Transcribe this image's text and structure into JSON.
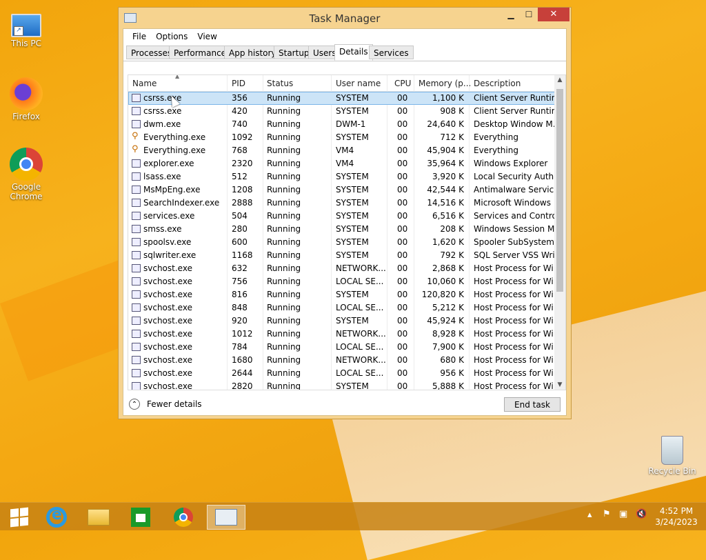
{
  "desktop": {
    "icons": [
      {
        "label": "This PC"
      },
      {
        "label": "Firefox"
      },
      {
        "label": "Google Chrome"
      },
      {
        "label": "Recycle Bin"
      }
    ]
  },
  "window": {
    "title": "Task Manager",
    "menu": [
      "File",
      "Options",
      "View"
    ],
    "tabs": [
      "Processes",
      "Performance",
      "App history",
      "Startup",
      "Users",
      "Details",
      "Services"
    ],
    "active_tab": "Details",
    "columns": [
      "Name",
      "PID",
      "Status",
      "User name",
      "CPU",
      "Memory (p...",
      "Description"
    ],
    "rows": [
      [
        "csrss.exe",
        "356",
        "Running",
        "SYSTEM",
        "00",
        "1,100 K",
        "Client Server Runtim..."
      ],
      [
        "csrss.exe",
        "420",
        "Running",
        "SYSTEM",
        "00",
        "908 K",
        "Client Server Runtim..."
      ],
      [
        "dwm.exe",
        "740",
        "Running",
        "DWM-1",
        "00",
        "24,640 K",
        "Desktop Window M..."
      ],
      [
        "Everything.exe",
        "1092",
        "Running",
        "SYSTEM",
        "00",
        "712 K",
        "Everything"
      ],
      [
        "Everything.exe",
        "768",
        "Running",
        "VM4",
        "00",
        "45,904 K",
        "Everything"
      ],
      [
        "explorer.exe",
        "2320",
        "Running",
        "VM4",
        "00",
        "35,964 K",
        "Windows Explorer"
      ],
      [
        "lsass.exe",
        "512",
        "Running",
        "SYSTEM",
        "00",
        "3,920 K",
        "Local Security Auth..."
      ],
      [
        "MsMpEng.exe",
        "1208",
        "Running",
        "SYSTEM",
        "00",
        "42,544 K",
        "Antimalware Service..."
      ],
      [
        "SearchIndexer.exe",
        "2888",
        "Running",
        "SYSTEM",
        "00",
        "14,516 K",
        "Microsoft Windows ..."
      ],
      [
        "services.exe",
        "504",
        "Running",
        "SYSTEM",
        "00",
        "6,516 K",
        "Services and Control..."
      ],
      [
        "smss.exe",
        "280",
        "Running",
        "SYSTEM",
        "00",
        "208 K",
        "Windows Session M..."
      ],
      [
        "spoolsv.exe",
        "600",
        "Running",
        "SYSTEM",
        "00",
        "1,620 K",
        "Spooler SubSystem ..."
      ],
      [
        "sqlwriter.exe",
        "1168",
        "Running",
        "SYSTEM",
        "00",
        "792 K",
        "SQL Server VSS Writ..."
      ],
      [
        "svchost.exe",
        "632",
        "Running",
        "NETWORK...",
        "00",
        "2,868 K",
        "Host Process for Wi..."
      ],
      [
        "svchost.exe",
        "756",
        "Running",
        "LOCAL SE...",
        "00",
        "10,060 K",
        "Host Process for Wi..."
      ],
      [
        "svchost.exe",
        "816",
        "Running",
        "SYSTEM",
        "00",
        "120,820 K",
        "Host Process for Wi..."
      ],
      [
        "svchost.exe",
        "848",
        "Running",
        "LOCAL SE...",
        "00",
        "5,212 K",
        "Host Process for Wi..."
      ],
      [
        "svchost.exe",
        "920",
        "Running",
        "SYSTEM",
        "00",
        "45,924 K",
        "Host Process for Wi..."
      ],
      [
        "svchost.exe",
        "1012",
        "Running",
        "NETWORK...",
        "00",
        "8,928 K",
        "Host Process for Wi..."
      ],
      [
        "svchost.exe",
        "784",
        "Running",
        "LOCAL SE...",
        "00",
        "7,900 K",
        "Host Process for Wi..."
      ],
      [
        "svchost.exe",
        "1680",
        "Running",
        "NETWORK...",
        "00",
        "680 K",
        "Host Process for Wi..."
      ],
      [
        "svchost.exe",
        "2644",
        "Running",
        "LOCAL SE...",
        "00",
        "956 K",
        "Host Process for Wi..."
      ],
      [
        "svchost.exe",
        "2820",
        "Running",
        "SYSTEM",
        "00",
        "5,888 K",
        "Host Process for Wi..."
      ]
    ],
    "selected_row": 0,
    "fewer_details": "Fewer details",
    "end_task": "End task"
  },
  "taskbar": {
    "items": [
      "start-icon",
      "internet-explorer-icon",
      "file-explorer-icon",
      "store-icon",
      "chrome-icon",
      "task-manager-icon"
    ],
    "clock": {
      "time": "4:52 PM",
      "date": "3/24/2023"
    }
  }
}
